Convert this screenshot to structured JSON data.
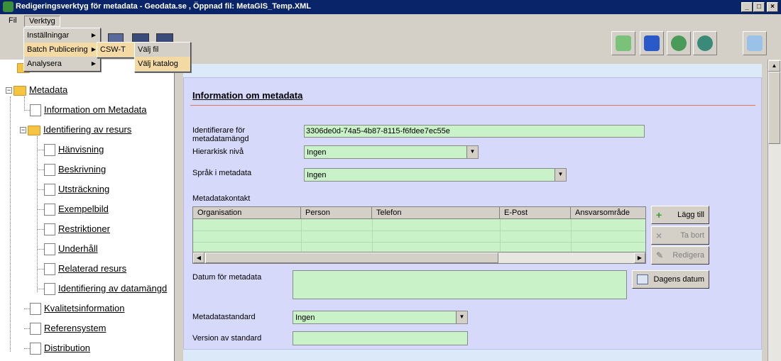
{
  "window": {
    "title": "Redigeringsverktyg för metadata - Geodata.se , Öppnad fil: MetaGIS_Temp.XML"
  },
  "menubar": {
    "fil": "Fil",
    "verktyg": "Verktyg"
  },
  "verktyg_menu": {
    "items": [
      {
        "label": "Inställningar"
      },
      {
        "label": "Batch Publicering"
      },
      {
        "label": "Analysera"
      }
    ]
  },
  "batch_submenu": {
    "items": [
      {
        "label": "CSW-T"
      }
    ]
  },
  "csw_submenu": {
    "items": [
      {
        "label": "Välj fil"
      },
      {
        "label": "Välj katalog"
      }
    ]
  },
  "toolbar": {
    "icons": [
      "validate-xml-icon",
      "save-icon",
      "upload-globe-icon",
      "remove-globe-icon",
      "edit-notes-icon"
    ]
  },
  "tree": {
    "root": "Metadata",
    "items": [
      {
        "label": "Information om Metadata"
      },
      {
        "label": "Identifiering av resurs"
      },
      {
        "label": "Hänvisning"
      },
      {
        "label": "Beskrivning"
      },
      {
        "label": "Utsträckning"
      },
      {
        "label": "Exempelbild"
      },
      {
        "label": "Restriktioner"
      },
      {
        "label": "Underhåll"
      },
      {
        "label": "Relaterad resurs"
      },
      {
        "label": "Identifiering av datamängd"
      },
      {
        "label": "Kvalitetsinformation"
      },
      {
        "label": "Referensystem"
      },
      {
        "label": "Distribution"
      }
    ]
  },
  "form": {
    "title": "Information om metadata",
    "identifier_label": "Identifierare för metadatamängd",
    "identifier_value": "3306de0d-74a5-4b87-8115-f6fdee7ec55e",
    "hierarchy_label": "Hierarkisk nivå",
    "hierarchy_value": "Ingen",
    "language_label": "Språk i metadata",
    "language_value": "Ingen",
    "contact_label": "Metadatakontakt",
    "contact_columns": [
      "Organisation",
      "Person",
      "Telefon",
      "E-Post",
      "Ansvarsområde"
    ],
    "add_button": "Lägg till",
    "remove_button": "Ta bort",
    "edit_button": "Redigera",
    "date_label": "Datum för metadata",
    "today_button": "Dagens datum",
    "standard_label": "Metadatastandard",
    "standard_value": "Ingen",
    "version_label": "Version av standard",
    "version_value": ""
  }
}
